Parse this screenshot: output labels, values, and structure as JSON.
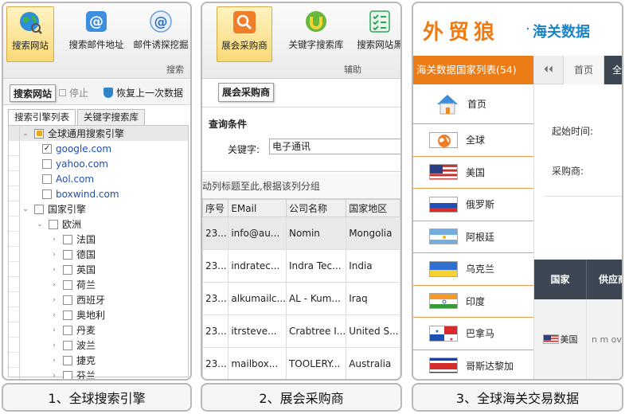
{
  "panel1": {
    "ribbon": {
      "buttons": [
        "搜索网站",
        "搜索邮件地址",
        "邮件诱探挖掘"
      ],
      "group": "搜索"
    },
    "toolbar": {
      "search_site": "搜索网站",
      "stop": "停止",
      "restore": "恢复上一次数据"
    },
    "tabs": [
      "搜索引擎列表",
      "关键字搜索库"
    ],
    "tree": {
      "global": "全球通用搜索引擎",
      "engines": [
        "google.com",
        "yahoo.com",
        "Aol.com",
        "boxwind.com"
      ],
      "country": "国家引擎",
      "europe": "欧洲",
      "countries": [
        "法国",
        "德国",
        "英国",
        "荷兰",
        "西班牙",
        "奥地利",
        "丹麦",
        "波兰",
        "捷克",
        "芬兰"
      ]
    },
    "caption": "1、全球搜索引擎"
  },
  "panel2": {
    "ribbon": {
      "buttons": [
        "展会采购商",
        "关键字搜索库",
        "搜索网站黑"
      ],
      "group": "辅助"
    },
    "title": "展会采购商",
    "query": {
      "title": "查询条件",
      "label": "关键字:",
      "value": "电子通讯"
    },
    "group_hint": "动列标题至此,根据该列分组",
    "table": {
      "headers": [
        "序号",
        "EMail",
        "公司名称",
        "国家地区"
      ],
      "rows": [
        [
          "23...",
          "info@au...",
          "Nomin",
          "Mongolia"
        ],
        [
          "23...",
          "indratec...",
          "Indra Tec...",
          "India"
        ],
        [
          "23...",
          "alkumailc...",
          "AL - Kum...",
          "Iraq"
        ],
        [
          "23...",
          "itrsteve...",
          "Crabtree I...",
          "United S..."
        ],
        [
          "23...",
          "mailbox...",
          "TOOLERY...",
          "Australia"
        ]
      ]
    },
    "caption": "2、展会采购商"
  },
  "panel3": {
    "logo": {
      "big": "外贸狼",
      "sub": "海关数据"
    },
    "country_list_title": "海关数据国家列表(54)",
    "countries": [
      "首页",
      "全球",
      "美国",
      "俄罗斯",
      "阿根廷",
      "乌克兰",
      "印度",
      "巴拿马",
      "哥斯达黎加"
    ],
    "nav": {
      "home": "首页",
      "dark_tab": "全"
    },
    "form": {
      "start_time": "起始时间:",
      "buyer": "采购商:"
    },
    "table": {
      "col_country": "国家",
      "col_supplier": "供应商",
      "row_country": "美国",
      "row_supplier": "n m ove"
    },
    "caption": "3、全球海关交易数据"
  },
  "colors": {
    "orange": "#ec7d16",
    "dark_header": "#3d4753",
    "link_blue": "#1f4fb3",
    "logo_blue": "#1a84c4"
  }
}
